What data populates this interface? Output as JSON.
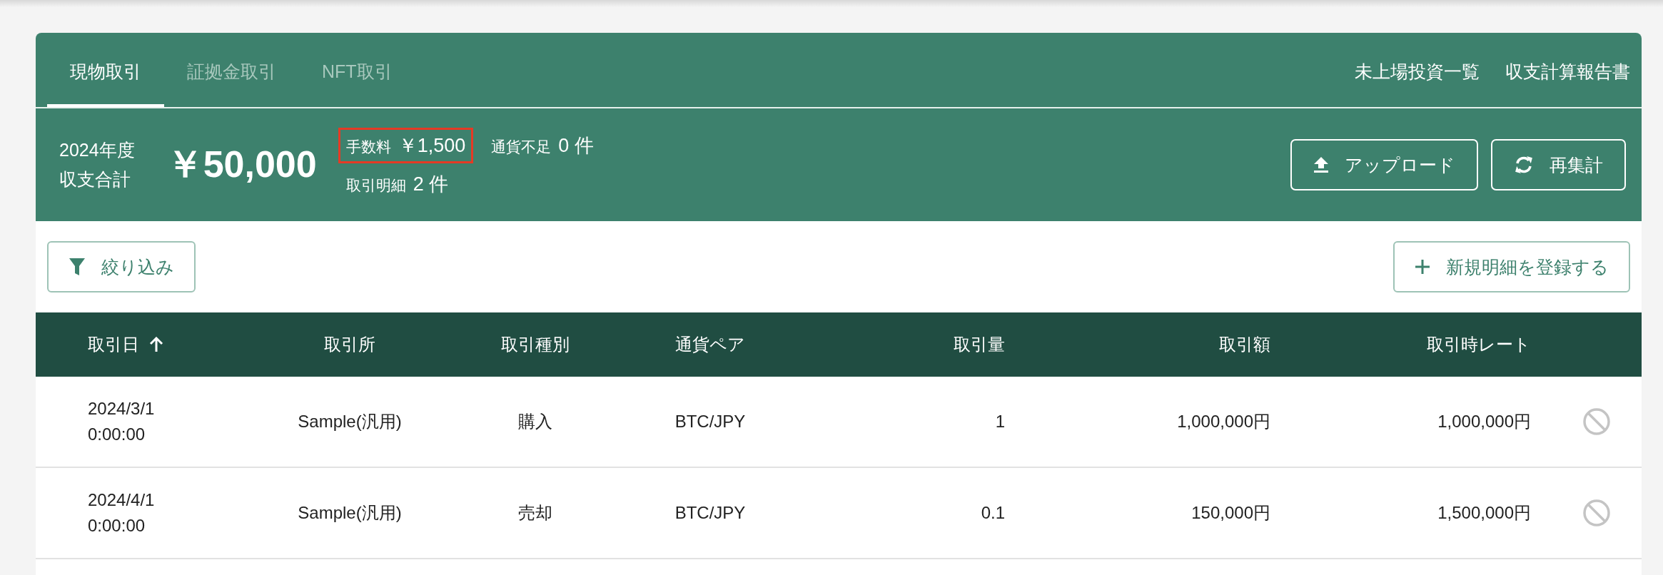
{
  "tabs": [
    {
      "label": "現物取引",
      "selected": true
    },
    {
      "label": "証拠金取引",
      "selected": false
    },
    {
      "label": "NFT取引",
      "selected": false
    }
  ],
  "links": [
    "未上場投資一覧",
    "収支計算報告書"
  ],
  "summary": {
    "year": "2024年度",
    "label": "収支合計",
    "total": "￥50,000",
    "stat_rows": [
      {
        "items": [
          {
            "label": "手数料",
            "value": "￥1,500",
            "highlighted": true
          },
          {
            "label": "通貨不足",
            "value": "0 件",
            "highlighted": false
          }
        ]
      },
      {
        "items": [
          {
            "label": "取引明細",
            "value": "2 件",
            "highlighted": false
          }
        ]
      }
    ],
    "actions": [
      {
        "kind": "upload",
        "label": "アップロード"
      },
      {
        "kind": "refresh",
        "label": "再集計"
      }
    ]
  },
  "toolbar": {
    "filter": "絞り込み",
    "add": "新規明細を登録する"
  },
  "table": {
    "columns": [
      {
        "label": "取引日",
        "sorted": true
      },
      {
        "label": "取引所",
        "sorted": false
      },
      {
        "label": "取引種別",
        "sorted": false
      },
      {
        "label": "通貨ペア",
        "sorted": false
      },
      {
        "label": "取引量",
        "sorted": false
      },
      {
        "label": "取引額",
        "sorted": false
      },
      {
        "label": "取引時レート",
        "sorted": false
      }
    ],
    "rows": [
      {
        "date": "2024/3/1 0:00:00",
        "exchange": "Sample(汎用)",
        "type": "購入",
        "pair": "BTC/JPY",
        "quantity": "1",
        "amount": "1,000,000円",
        "rate": "1,000,000円"
      },
      {
        "date": "2024/4/1 0:00:00",
        "exchange": "Sample(汎用)",
        "type": "売却",
        "pair": "BTC/JPY",
        "quantity": "0.1",
        "amount": "150,000円",
        "rate": "1,500,000円"
      }
    ]
  }
}
